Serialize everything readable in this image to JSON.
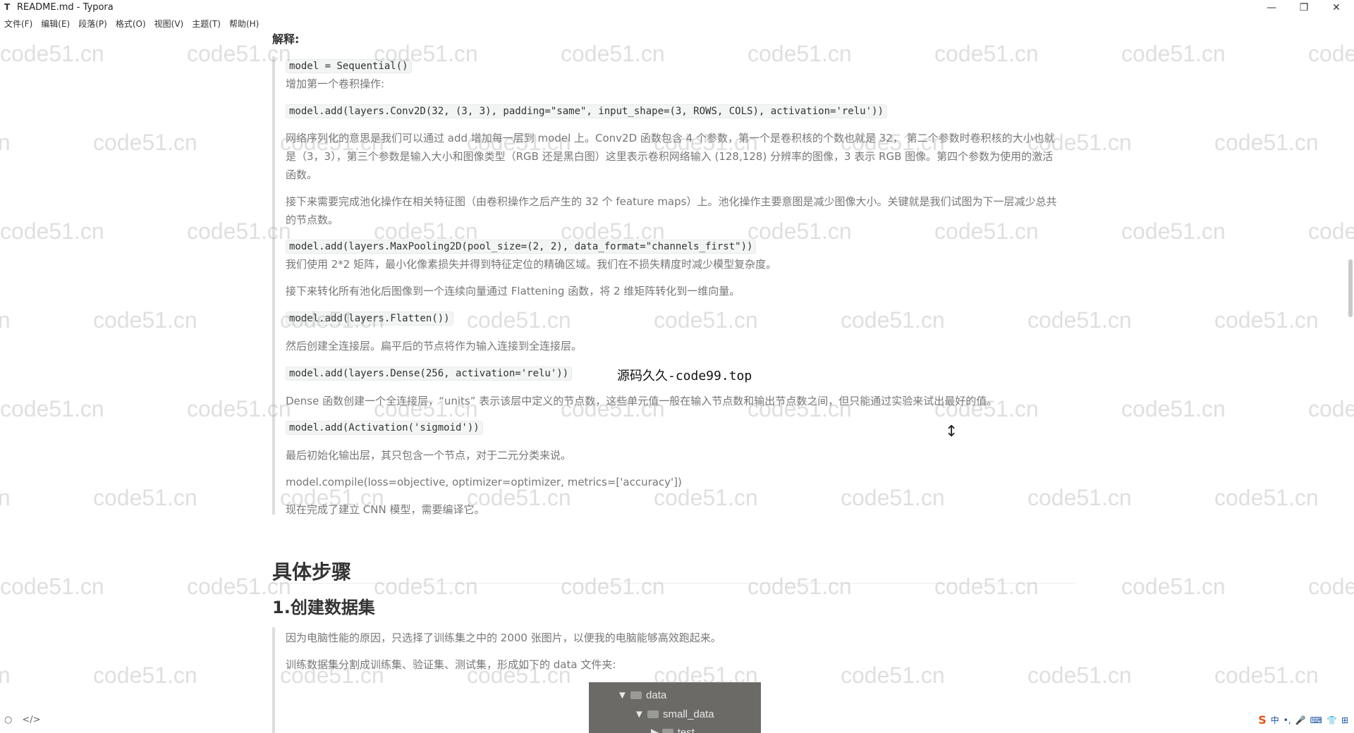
{
  "window": {
    "app_icon": "T",
    "title": "README.md - Typora",
    "minimize": "—",
    "maximize": "❐",
    "close": "✕"
  },
  "menu": [
    "文件(F)",
    "编辑(E)",
    "段落(P)",
    "格式(O)",
    "视图(V)",
    "主题(T)",
    "帮助(H)"
  ],
  "watermark": "code51.cn",
  "doc": {
    "label": "解释:",
    "code1": "model = Sequential()",
    "p1": "增加第一个卷积操作:",
    "code2": "model.add(layers.Conv2D(32, (3, 3), padding=\"same\", input_shape=(3, ROWS, COLS), activation='relu'))",
    "p2": "网络序列化的意思是我们可以通过 add 增加每一层到 model 上。Conv2D 函数包含 4 个参数，第一个是卷积核的个数也就是 32， 第二个参数时卷积核的大小也就是（3，3），第三个参数是输入大小和图像类型（RGB 还是黑白图）这里表示卷积网络输入 (128,128) 分辨率的图像，3 表示 RGB 图像。第四个参数为使用的激活函数。",
    "p3": "接下来需要完成池化操作在相关特征图（由卷积操作之后产生的 32 个 feature maps）上。池化操作主要意图是减少图像大小。关键就是我们试图为下一层减少总共的节点数。",
    "code3": "model.add(layers.MaxPooling2D(pool_size=(2, 2), data_format=\"channels_first\"))",
    "p4": "我们使用 2*2 矩阵，最小化像素损失并得到特征定位的精确区域。我们在不损失精度时减少模型复杂度。",
    "p5": "接下来转化所有池化后图像到一个连续向量通过 Flattening 函数，将 2 维矩阵转化到一维向量。",
    "code4": "model.add(layers.Flatten())",
    "p6": "然后创建全连接层。扁平后的节点将作为输入连接到全连接层。",
    "code5": "model.add(layers.Dense(256, activation='relu'))",
    "overlay": "源码久久-code99.top",
    "p7": "Dense 函数创建一个全连接层，“units” 表示该层中定义的节点数，这些单元值一般在输入节点数和输出节点数之间，但只能通过实验来试出最好的值。",
    "code6": "model.add(Activation('sigmoid'))",
    "p8": "最后初始化输出层，其只包含一个节点，对于二元分类来说。",
    "p9": "model.compile(loss=objective, optimizer=optimizer, metrics=['accuracy'])",
    "p10": "现在完成了建立 CNN 模型，需要编译它。",
    "h2": "具体步骤",
    "h3": "1.创建数据集",
    "p11": "因为电脑性能的原因，只选择了训练集之中的 2000 张图片，以便我的电脑能够高效跑起来。",
    "p12": "训练数据集分割成训练集、验证集、测试集，形成如下的 data 文件夹:",
    "tree": [
      "data",
      "small_data",
      "test"
    ]
  },
  "statusbar": {
    "left_icon1": "○",
    "left_icon2": "</>"
  },
  "tray": [
    "S",
    "中",
    "•,",
    "🎤",
    "⌨",
    "👕",
    "⊞"
  ]
}
